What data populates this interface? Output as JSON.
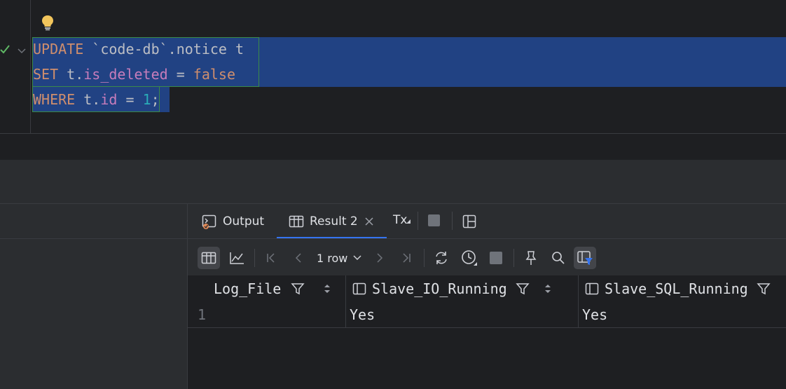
{
  "editor": {
    "line1": {
      "kw": "UPDATE",
      "table": " `code-db`.notice t"
    },
    "line2": {
      "kw": "SET",
      "t_prefix": " t.",
      "col": "is_deleted",
      "eq": " = ",
      "val": "false"
    },
    "line3": {
      "kw": "WHERE",
      "t_prefix": " t.",
      "col": "id",
      "eq": " = ",
      "num": "1",
      "semi": ";"
    }
  },
  "tabs": {
    "output_label": "Output",
    "result_label": "Result 2",
    "tx_label": "Tx"
  },
  "toolbar": {
    "rows_label": "1 row"
  },
  "grid": {
    "columns": [
      "Log_File",
      "Slave_IO_Running",
      "Slave_SQL_Running"
    ],
    "row_number": "1",
    "row": [
      "",
      "Yes",
      "Yes"
    ]
  },
  "colors": {
    "selection": "#214283",
    "keyword": "#cf8e6d",
    "column": "#c77dbb",
    "number": "#2aacb8",
    "accent": "#3574f0",
    "success": "#5fb865",
    "bulb": "#f2c55c"
  }
}
